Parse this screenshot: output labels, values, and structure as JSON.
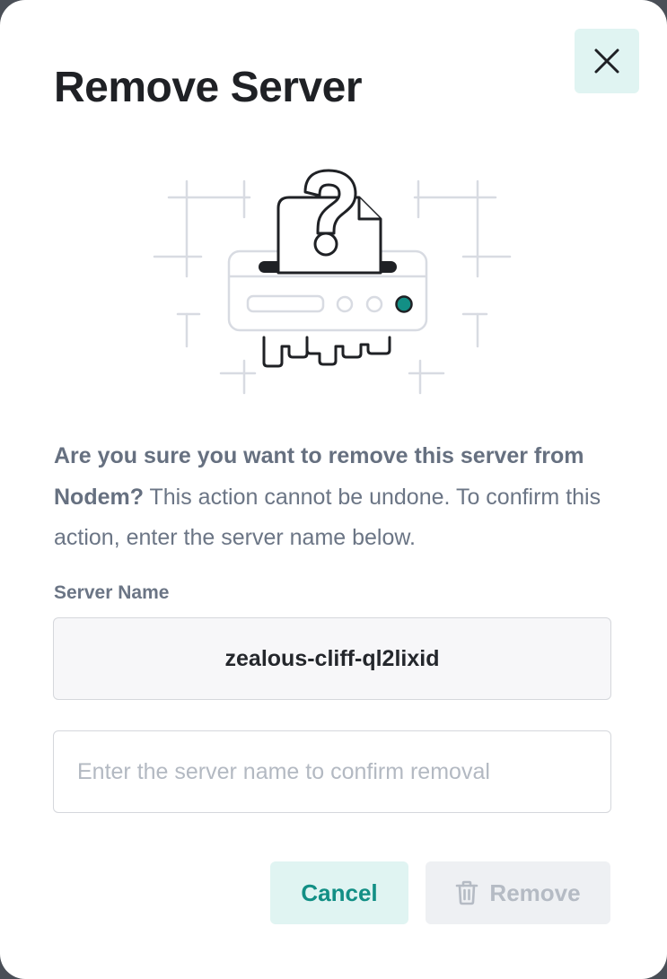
{
  "dialog": {
    "title": "Remove Server",
    "close_icon": "close-icon",
    "illustration_icon": "server-question-icon",
    "message_bold": "Are you sure you want to remove this server from Nodem?",
    "message_rest": " This action cannot be undone. To confirm this action, enter the server name below.",
    "field_label": "Server Name",
    "server_name": "zealous-cliff-ql2lixid",
    "confirm_input": {
      "value": "",
      "placeholder": "Enter the server name to confirm removal"
    },
    "cancel_label": "Cancel",
    "remove_label": "Remove",
    "remove_icon": "trash-icon"
  },
  "colors": {
    "accent": "#128f85",
    "accent_bg": "#e0f4f2",
    "title": "#1f2125",
    "muted_text": "#6b7585",
    "disabled_text": "#b5bbc4",
    "status_dot": "#128f85"
  }
}
